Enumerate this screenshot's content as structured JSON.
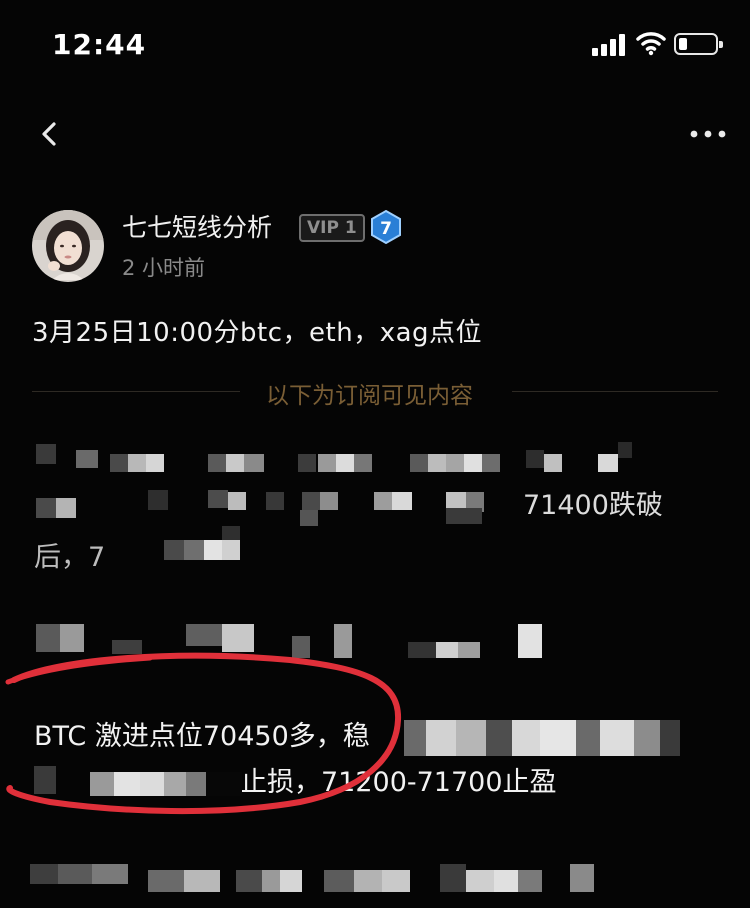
{
  "status_bar": {
    "time": "12:44",
    "signal_icon": "cellular-signal-icon",
    "wifi_icon": "wifi-icon",
    "battery_icon": "battery-icon",
    "battery_level": 0.2
  },
  "nav": {
    "back_icon": "chevron-left-icon",
    "more_icon": "more-horizontal-icon"
  },
  "author": {
    "name": "七七短线分析",
    "vip_label": "VIP 1",
    "level": "7",
    "time_ago": "2 小时前",
    "avatar_icon": "avatar-photo"
  },
  "post": {
    "title": "3月25日10:00分btc，eth，xag点位",
    "subscriber_divider": "以下为订阅可见内容",
    "line_1_visible": "71400跌破",
    "line_2_visible": "后，7",
    "btc_line_1": "BTC 激进点位70450多，稳",
    "btc_line_2": "止损，71200-71700止盈"
  },
  "colors": {
    "background": "#050505",
    "divider_text": "#7a5e35",
    "highlight": "#e0303a",
    "level_badge": "#2a7fd6"
  }
}
